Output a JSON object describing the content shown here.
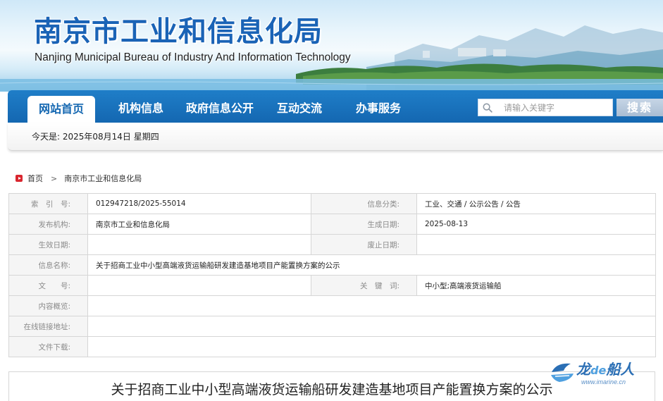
{
  "header": {
    "title": "南京市工业和信息化局",
    "subtitle": "Nanjing Municipal Bureau of Industry And Information Technology"
  },
  "nav": {
    "items": [
      "网站首页",
      "机构信息",
      "政府信息公开",
      "互动交流",
      "办事服务"
    ],
    "active_index": 0
  },
  "search": {
    "placeholder": "请输入关键字",
    "button_label": "搜索",
    "icon": "search-icon"
  },
  "date_bar": {
    "text": "今天是:  2025年08月14日  星期四"
  },
  "breadcrumb": {
    "items": [
      "首页",
      "南京市工业和信息化局"
    ],
    "separator": ">"
  },
  "info": {
    "rows": [
      [
        {
          "label": "索　引　号:",
          "value": "012947218/2025-55014"
        },
        {
          "label": "信息分类:",
          "value": "工业、交通 / 公示公告 / 公告"
        }
      ],
      [
        {
          "label": "发布机构:",
          "value": "南京市工业和信息化局"
        },
        {
          "label": "生成日期:",
          "value": "2025-08-13"
        }
      ],
      [
        {
          "label": "生效日期:",
          "value": ""
        },
        {
          "label": "废止日期:",
          "value": ""
        }
      ],
      [
        {
          "label": "信息名称:",
          "value": "关于招商工业中小型高端液货运输船研发建造基地项目产能置换方案的公示"
        }
      ],
      [
        {
          "label": "文　　号:",
          "value": ""
        },
        {
          "label": "关　键　词:",
          "value": "中小型;高端液货运输船"
        }
      ],
      [
        {
          "label": "内容概览:",
          "value": ""
        }
      ],
      [
        {
          "label": "在线链接地址:",
          "value": ""
        }
      ],
      [
        {
          "label": "文件下载:",
          "value": ""
        }
      ]
    ]
  },
  "article": {
    "title": "关于招商工业中小型高端液货运输船研发建造基地项目产能置换方案的公示"
  },
  "watermark": {
    "brand_pre": "龙",
    "brand_de": "de",
    "brand_post": "船人",
    "url": "www.imarine.cn"
  },
  "colors": {
    "nav_blue": "#1467b1",
    "title_blue": "#1a63b6",
    "home_icon_red": "#d9262f"
  }
}
